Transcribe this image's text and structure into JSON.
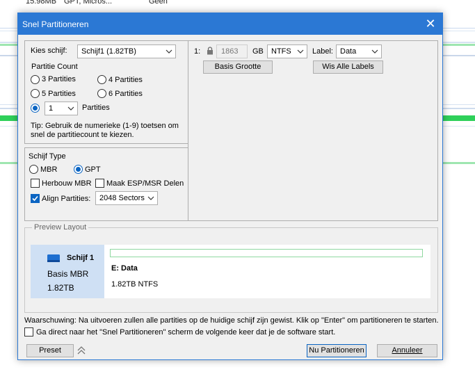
{
  "background_window": {
    "row_size": "15.98MB",
    "row_type": "GPT, Micros...",
    "row_status": "Geen"
  },
  "dialog": {
    "title": "Snel Partitioneren",
    "close_glyph": "✕"
  },
  "disk_select": {
    "label": "Kies schijf:",
    "value": "Schijf1 (1.82TB)"
  },
  "partition_count": {
    "heading": "Partitie Count",
    "options": [
      "3 Partities",
      "4 Partities",
      "5 Partities",
      "6 Partities"
    ],
    "custom_value": "1",
    "custom_label": "Partities",
    "tip": "Tip: Gebruik de numerieke (1-9) toetsen om snel de partitiecount te kiezen."
  },
  "disk_type": {
    "heading": "Schijf Type",
    "mbr_label": "MBR",
    "gpt_label": "GPT",
    "rebuild_mbr_label": "Herbouw MBR",
    "esp_msr_label": "Maak ESP/MSR Delen",
    "align_label": "Align Partities:",
    "align_value": "2048 Sectors"
  },
  "partition_row": {
    "index": "1:",
    "size_value": "1863",
    "size_unit": "GB",
    "filesystem": "NTFS",
    "label_caption": "Label:",
    "label_value": "Data",
    "base_size_button": "Basis Grootte",
    "clear_labels_button": "Wis Alle Labels"
  },
  "preview": {
    "heading": "Preview Layout",
    "disk_name": "Schijf 1",
    "disk_kind": "Basis MBR",
    "disk_size": "1.82TB",
    "partition_name": "E: Data",
    "partition_info": "1.82TB NTFS"
  },
  "footer": {
    "warning": "Waarschuwing: Na uitvoeren zullen alle partities op de huidige schijf zijn gewist. Klik op \"Enter\" om partitioneren te starten.",
    "skip_label": "Ga direct naar het \"Snel Partitioneren\" scherm de volgende keer dat je de software start.",
    "preset_button": "Preset",
    "go_button": "Nu Partitioneren",
    "cancel_button": "Annuleer"
  },
  "colors": {
    "accent": "#2b78d4",
    "selected": "#0a64c2",
    "green_bar": "#2fd05a"
  }
}
